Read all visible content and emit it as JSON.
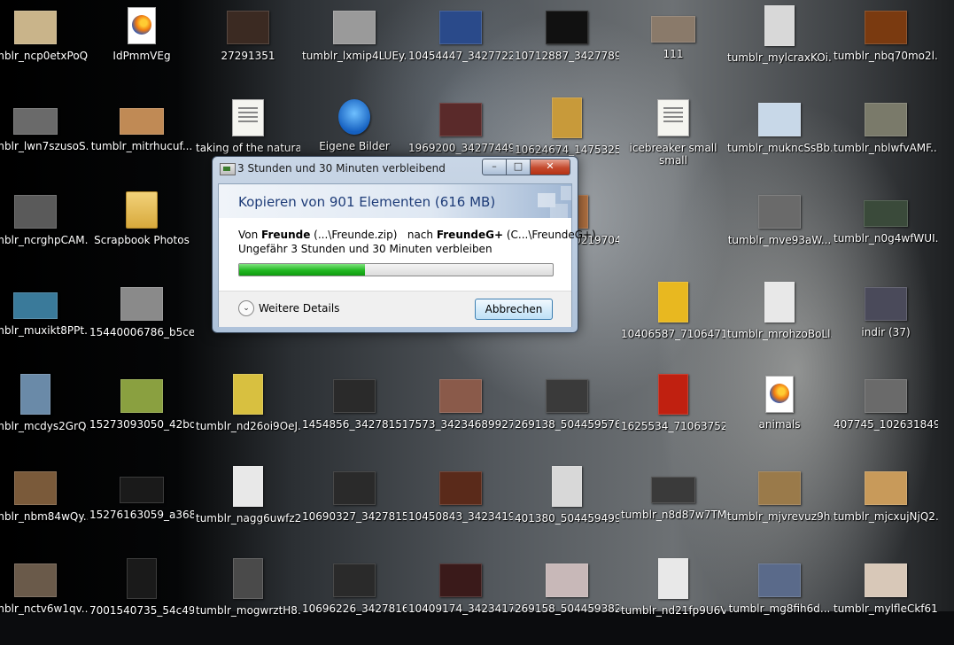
{
  "desktop_icons": [
    {
      "label": "tumblr_ncp0etxPoQ...",
      "thumb": "#c9b48a",
      "kind": "photo"
    },
    {
      "label": "IdPmmVEg",
      "thumb": "#ffffff",
      "kind": "firefox"
    },
    {
      "label": "27291351",
      "thumb": "#3b2a22",
      "kind": "photo"
    },
    {
      "label": "tumblr_lxmip4LUEy...",
      "thumb": "#9a9a9a",
      "kind": "photo"
    },
    {
      "label": "10454447_342772238...",
      "thumb": "#2a4a8a",
      "kind": "photo"
    },
    {
      "label": "10712887_342778955...",
      "thumb": "#111111",
      "kind": "photo"
    },
    {
      "label": "111",
      "thumb": "#8a7a6a",
      "kind": "wide"
    },
    {
      "label": "tumblr_mylcraxKOi...",
      "thumb": "#d8d8d8",
      "kind": "tall"
    },
    {
      "label": "tumblr_nbq70mo2l...",
      "thumb": "#7a3a10",
      "kind": "photo"
    },
    {
      "label": "tumblr_lwn7szusoS...",
      "thumb": "#6a6a6a",
      "kind": "wide"
    },
    {
      "label": "tumblr_mitrhucuf...",
      "thumb": "#c08a55",
      "kind": "wide"
    },
    {
      "label": "taking of the natural",
      "thumb": "#f5f5f0",
      "kind": "doc"
    },
    {
      "label": "Eigene Bilder",
      "thumb": "#2a7ad8",
      "kind": "shortcut"
    },
    {
      "label": "1969200_342774492...",
      "thumb": "#5a2a2a",
      "kind": "photo"
    },
    {
      "label": "10624674_14753252...",
      "thumb": "#c89a3a",
      "kind": "tall"
    },
    {
      "label": "icebreaker small small",
      "thumb": "#f5f5f0",
      "kind": "doc"
    },
    {
      "label": "tumblr_mukncSsBb...",
      "thumb": "#c8d8e8",
      "kind": "photo"
    },
    {
      "label": "tumblr_nblwfvAMF...",
      "thumb": "#7a7a6a",
      "kind": "photo"
    },
    {
      "label": "tumblr_ncrghpCAM...",
      "thumb": "#5a5a5a",
      "kind": "photo"
    },
    {
      "label": "Scrapbook Photos",
      "thumb": "#e6c26a",
      "kind": "folder"
    },
    {
      "label": "482897_3902197043...",
      "thumb": "#b07040",
      "kind": "photo"
    },
    {
      "label": "tumblr_mve93aW...",
      "thumb": "#6a6a6a",
      "kind": "photo"
    },
    {
      "label": "tumblr_n0g4wfWUI...",
      "thumb": "#3a4a3a",
      "kind": "wide"
    },
    {
      "label": "tumblr_muxikt8PPt...",
      "thumb": "#3a7a9a",
      "kind": "wide"
    },
    {
      "label": "15440006786_b5ce5...",
      "thumb": "#8a8a8a",
      "kind": "photo"
    },
    {
      "label": "10406587_71064718...",
      "thumb": "#e8b820",
      "kind": "tall"
    },
    {
      "label": "tumblr_mrohzoBoLl...",
      "thumb": "#e8e8e8",
      "kind": "tall"
    },
    {
      "label": "indir (37)",
      "thumb": "#4a4a5a",
      "kind": "photo"
    },
    {
      "label": "tumblr_mcdys2GrQ...",
      "thumb": "#6a8aa8",
      "kind": "tall"
    },
    {
      "label": "15273093050_42bd1...",
      "thumb": "#8aa040",
      "kind": "photo"
    },
    {
      "label": "tumblr_nd26oi9OeJ...",
      "thumb": "#d8c040",
      "kind": "tall"
    },
    {
      "label": "1454856_342781512...",
      "thumb": "#2a2a2a",
      "kind": "photo"
    },
    {
      "label": "7573_342346899270...",
      "thumb": "#8a5a4a",
      "kind": "photo"
    },
    {
      "label": "269138_5044595762...",
      "thumb": "#3a3a3a",
      "kind": "photo"
    },
    {
      "label": "1625534_710637525...",
      "thumb": "#c02010",
      "kind": "tall"
    },
    {
      "label": "animals",
      "thumb": "#ffffff",
      "kind": "firefox"
    },
    {
      "label": "407745_1026318499...",
      "thumb": "#6a6a6a",
      "kind": "photo"
    },
    {
      "label": "tumblr_nbm84wQy...",
      "thumb": "#7a5a3a",
      "kind": "photo"
    },
    {
      "label": "15276163059_a3681...",
      "thumb": "#1a1a1a",
      "kind": "wide"
    },
    {
      "label": "tumblr_nagg6uwfz2...",
      "thumb": "#e8e8e8",
      "kind": "tall"
    },
    {
      "label": "10690327_34278158...",
      "thumb": "#2a2a2a",
      "kind": "photo"
    },
    {
      "label": "10450843_34234196...",
      "thumb": "#5a2a1a",
      "kind": "photo"
    },
    {
      "label": "401380_5044594995...",
      "thumb": "#d8d8d8",
      "kind": "tall"
    },
    {
      "label": "tumblr_n8d87w7TM...",
      "thumb": "#3a3a3a",
      "kind": "wide"
    },
    {
      "label": "tumblr_mjvrevuz9h...",
      "thumb": "#9a7a4a",
      "kind": "photo"
    },
    {
      "label": "tumblr_mjcxujNjQ2...",
      "thumb": "#c89a5a",
      "kind": "photo"
    },
    {
      "label": "tumblr_nctv6w1qv...",
      "thumb": "#6a5a4a",
      "kind": "photo"
    },
    {
      "label": "7001540735_54c49d...",
      "thumb": "#1a1a1a",
      "kind": "tall"
    },
    {
      "label": "tumblr_mogwrztH8...",
      "thumb": "#4a4a4a",
      "kind": "tall"
    },
    {
      "label": "10696226_34278164...",
      "thumb": "#2a2a2a",
      "kind": "photo"
    },
    {
      "label": "10409174_34234171...",
      "thumb": "#3a1a1a",
      "kind": "photo"
    },
    {
      "label": "269158_5044593828...",
      "thumb": "#c8b8b8",
      "kind": "photo"
    },
    {
      "label": "tumblr_nd21fp9U6V...",
      "thumb": "#e8e8e8",
      "kind": "tall"
    },
    {
      "label": "tumblr_mg8fih6d...",
      "thumb": "#5a6a8a",
      "kind": "photo"
    },
    {
      "label": "tumblr_mylfleCkf61...",
      "thumb": "#d8c8b8",
      "kind": "photo"
    }
  ],
  "dialog": {
    "title": "3 Stunden und 30 Minuten verbleibend",
    "min_label": "–",
    "max_label": "□",
    "close_label": "✕",
    "header": "Kopieren von 901 Elementen (616 MB)",
    "from_prefix": "Von ",
    "from_name": "Freunde",
    "from_path": " (...\\Freunde.zip)",
    "to_prefix": "nach ",
    "to_name": "FreundeG+",
    "to_path": " (C...\\FreundeG+)",
    "time_remaining": "Ungefähr 3 Stunden und 30 Minuten verbleiben",
    "progress_fraction": 0.4,
    "details_icon": "chevron-down-icon",
    "details_chevron": "⌄",
    "details_label": "Weitere Details",
    "cancel_label": "Abbrechen"
  }
}
